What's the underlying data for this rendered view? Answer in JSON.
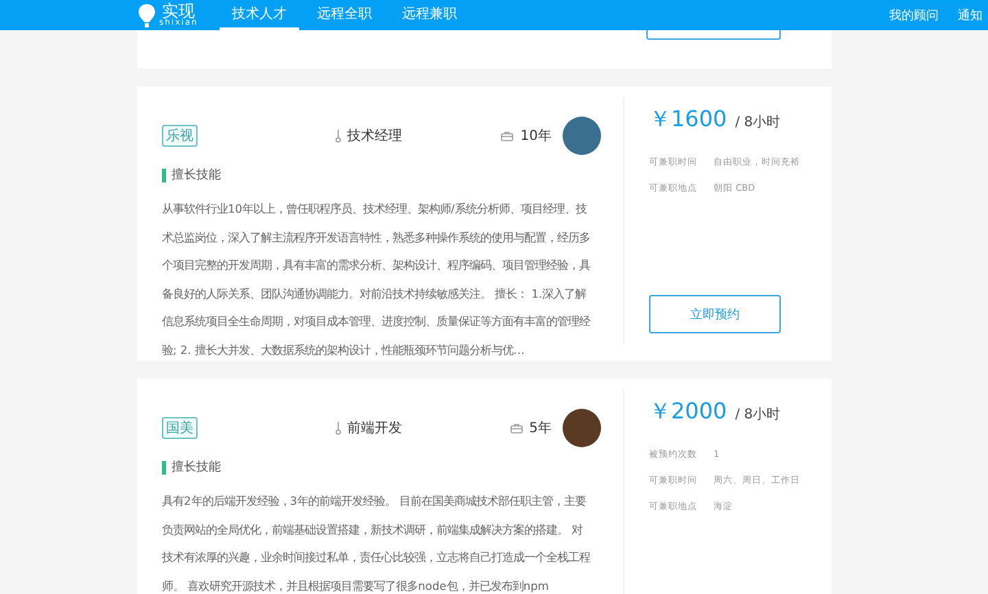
{
  "nav": {
    "logo_text": "实现",
    "logo_subtitle": "shixian",
    "tabs": [
      {
        "label": "技术人才",
        "selected": true
      },
      {
        "label": "远程全职",
        "selected": false
      },
      {
        "label": "远程兼职",
        "selected": false
      }
    ],
    "links": [
      "我的顾问",
      "通知"
    ]
  },
  "cards": [
    {
      "company": "乐视",
      "title": "技术经理",
      "experience": "10年",
      "skills_heading": "擅长技能",
      "description": "从事软件行业10年以上，曾任职程序员、技术经理、架构师/系统分析师、项目经理、技术总监岗位，深入了解主流程序开发语言特性，熟悉多种操作系统的使用与配置，经历多个项目完整的开发周期，具有丰富的需求分析、架构设计、程序编码、项目管理经验，具备良好的人际关系、团队沟通协调能力。对前沿技术持续敏感关注。 擅长： 1.深入了解信息系统项目全生命周期，对项目成本管理、进度控制、质量保证等方面有丰富的管理经验; 2. 擅长大并发、大数据系统的架构设计，性能瓶颈环节问题分析与优…",
      "price": "￥1600",
      "unit": "/ 8小时",
      "info": [
        {
          "label": "可兼职时间",
          "value": "自由职业，时间充裕"
        },
        {
          "label": "可兼职地点",
          "value": "朝阳 CBD"
        }
      ],
      "button": "立即预约"
    },
    {
      "company": "国美",
      "title": "前端开发",
      "experience": "5年",
      "skills_heading": "擅长技能",
      "description": "具有2年的后端开发经验，3年的前端开发经验。 目前在国美商城技术部任职主管，主要负责网站的全局优化，前端基础设置搭建，新技术调研，前端集成解决方案的搭建。 对技术有浓厚的兴趣，业余时间接过私单，责任心比较强，立志将自己打造成一个全栈工程师。 喜欢研究开源技术，并且根据项目需要写了很多node包，并已发布到npm",
      "price": "￥2000",
      "unit": "/ 8小时",
      "info": [
        {
          "label": "被预约次数",
          "value": "1"
        },
        {
          "label": "可兼职时间",
          "value": "周六、周日、工作日"
        },
        {
          "label": "可兼职地点",
          "value": "海淀"
        }
      ]
    }
  ]
}
